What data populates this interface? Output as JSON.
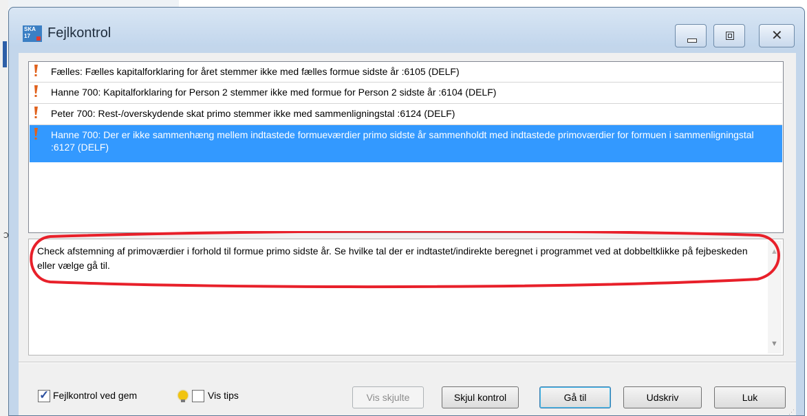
{
  "window": {
    "title": "Fejlkontrol",
    "app_icon_text": "SKA 17"
  },
  "messages": [
    {
      "text": "Fælles: Fælles kapitalforklaring for året stemmer ikke med fælles formue sidste år :6105 (DELF)",
      "selected": false
    },
    {
      "text": "Hanne 700: Kapitalforklaring for Person 2 stemmer ikke med formue for Person 2 sidste år :6104 (DELF)",
      "selected": false
    },
    {
      "text": "Peter 700: Rest-/overskydende skat primo stemmer ikke med sammenligningstal :6124 (DELF)",
      "selected": false
    },
    {
      "text": "Hanne 700: Der er ikke sammenhæng mellem indtastede formueværdier primo sidste år sammenholdt med indtastede primoværdier for formuen i sammenligningstal :6127 (DELF)",
      "selected": true
    }
  ],
  "detail": {
    "text": "Check afstemning af primoværdier i forhold til formue primo sidste år. Se hvilke tal der er indtastet/indirekte beregnet i programmet ved at dobbeltklikke på fejbeskeden eller vælge gå til."
  },
  "options": {
    "fejlkontrol_ved_gem": {
      "label": "Fejlkontrol ved gem",
      "checked": true
    },
    "vis_tips": {
      "label": "Vis tips",
      "checked": false
    }
  },
  "buttons": {
    "vis_skjulte": "Vis skjulte",
    "skjul_kontrol": "Skjul kontrol",
    "gaa_til": "Gå til",
    "udskriv": "Udskriv",
    "luk": "Luk"
  },
  "colors": {
    "selection": "#3399ff",
    "warning_icon": "#e0611c",
    "annotation": "#e8202a"
  },
  "icons": {
    "message": "exclamation-warning-icon",
    "tips": "lightbulb-icon"
  }
}
